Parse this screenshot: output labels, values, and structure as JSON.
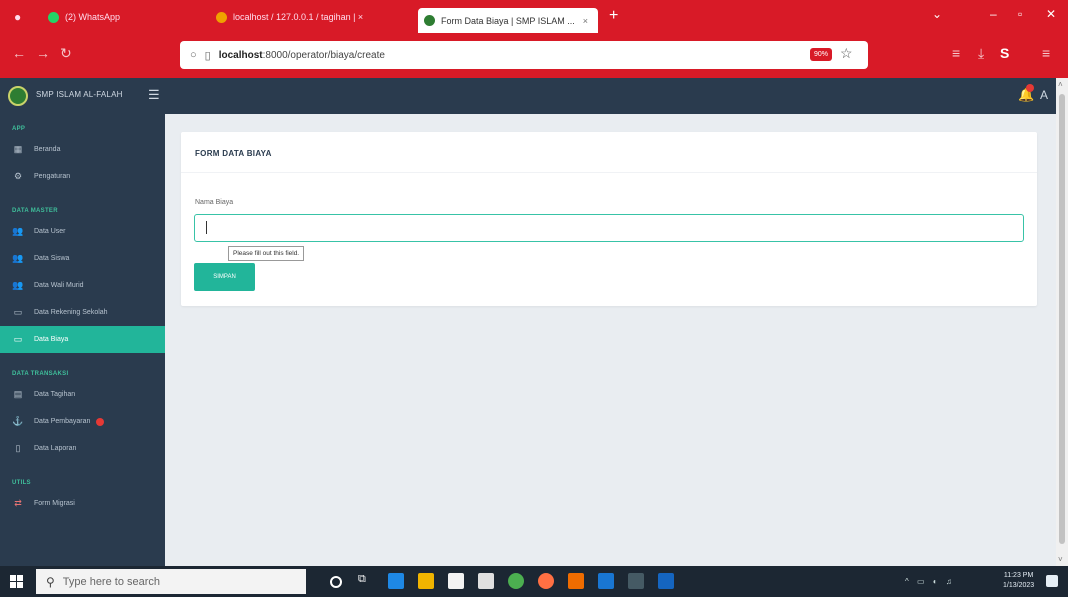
{
  "browser": {
    "tabs": [
      {
        "title": "(2) WhatsApp",
        "active": false,
        "color": "#25d366"
      },
      {
        "title": "localhost / 127.0.0.1 / tagihan | ×",
        "active": false,
        "color": "#f0a000"
      },
      {
        "title": "Form Data Biaya | SMP ISLAM ...",
        "active": true,
        "color": "#2e7d32"
      }
    ],
    "new_tab": "+",
    "url_host": "localhost",
    "url_path": ":8000/operator/biaya/create",
    "zoom_badge": "90%"
  },
  "app": {
    "brand": "SMP ISLAM AL-FALAH",
    "user_initial": "A"
  },
  "sidebar": {
    "sections": [
      {
        "title": "APP",
        "items": [
          {
            "label": "Beranda",
            "icon": "dashboard-icon"
          },
          {
            "label": "Pengaturan",
            "icon": "gear-icon"
          }
        ]
      },
      {
        "title": "DATA MASTER",
        "items": [
          {
            "label": "Data User",
            "icon": "users-icon"
          },
          {
            "label": "Data Siswa",
            "icon": "users-icon"
          },
          {
            "label": "Data Wali Murid",
            "icon": "users-icon"
          },
          {
            "label": "Data Rekening Sekolah",
            "icon": "card-icon"
          },
          {
            "label": "Data Biaya",
            "icon": "card-icon",
            "active": true
          }
        ]
      },
      {
        "title": "DATA TRANSAKSI",
        "items": [
          {
            "label": "Data Tagihan",
            "icon": "calendar-icon"
          },
          {
            "label": "Data Pembayaran",
            "icon": "anchor-icon",
            "badge": true
          },
          {
            "label": "Data Laporan",
            "icon": "doc-icon"
          }
        ]
      },
      {
        "title": "UTILS",
        "items": [
          {
            "label": "Form Migrasi",
            "icon": "migrate-icon"
          }
        ]
      }
    ]
  },
  "form": {
    "title": "FORM DATA BIAYA",
    "field_label": "Nama Biaya",
    "field_value": "",
    "validation_tooltip": "Please fill out this field.",
    "submit_label": "SIMPAN"
  },
  "taskbar": {
    "search_placeholder": "Type here to search",
    "time": "11:23 PM",
    "date": "1/13/2023"
  }
}
